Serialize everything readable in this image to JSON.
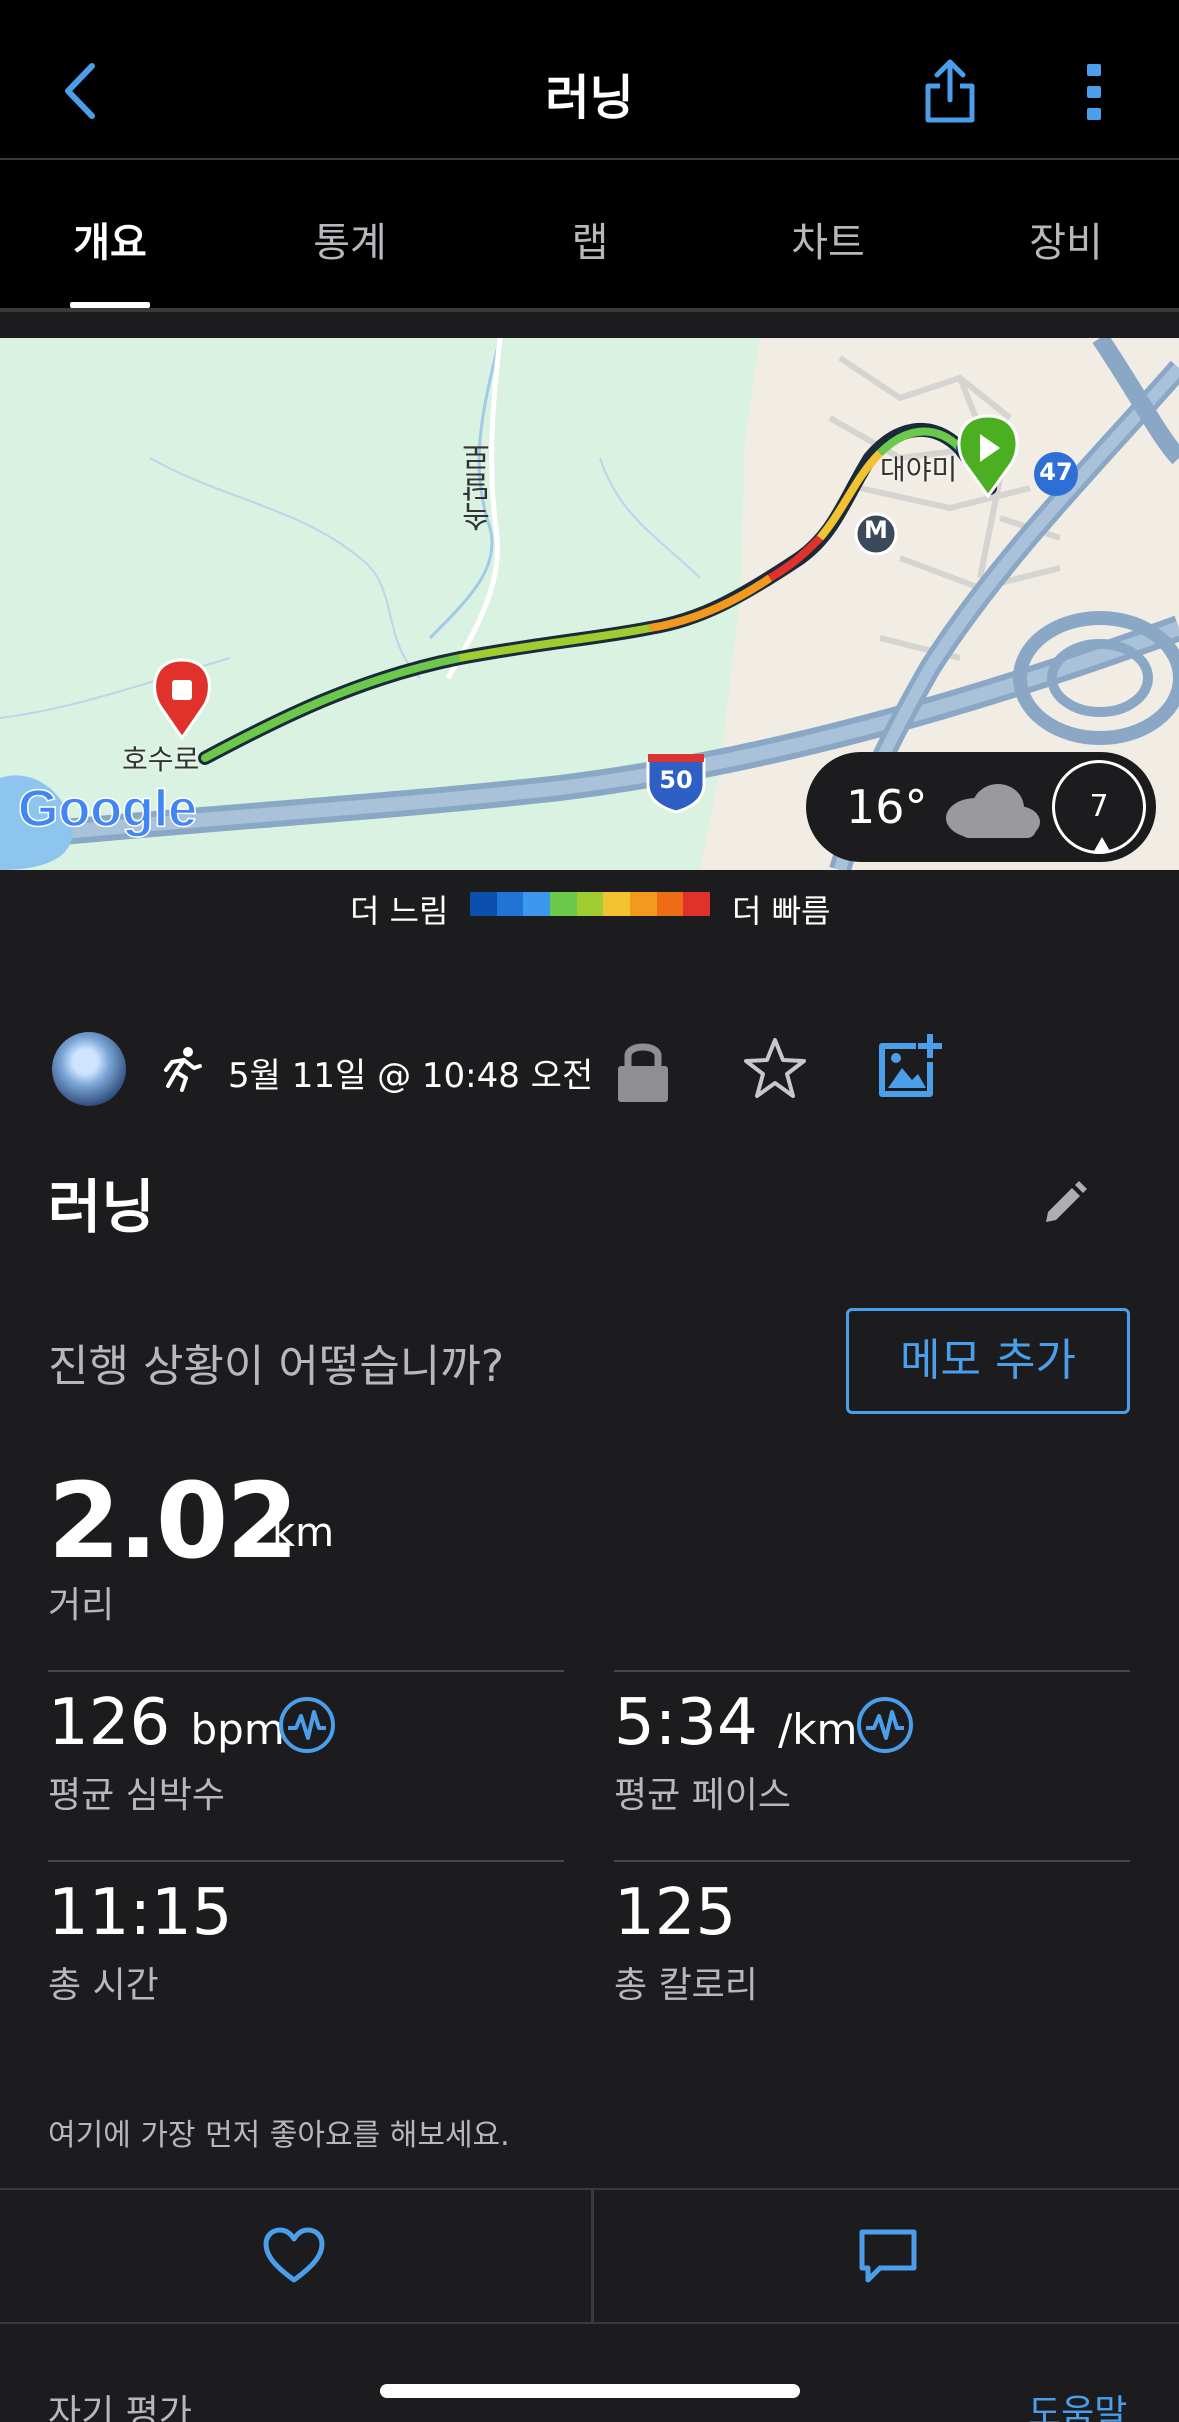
{
  "header": {
    "title": "러닝"
  },
  "tabs": [
    {
      "label": "개요",
      "active": true
    },
    {
      "label": "통계",
      "active": false
    },
    {
      "label": "랩",
      "active": false
    },
    {
      "label": "차트",
      "active": false
    },
    {
      "label": "장비",
      "active": false
    }
  ],
  "map": {
    "labels": {
      "road_vertical": "속달로",
      "place_end": "호수로",
      "place_start": "대야미",
      "route_50": "50",
      "route_47": "47",
      "metro": "M",
      "provider": "Google"
    },
    "weather": {
      "temperature": "16°",
      "wind_speed": "7"
    }
  },
  "pace_legend": {
    "slow_label": "더 느림",
    "fast_label": "더 빠름",
    "colors": [
      "#0a4fae",
      "#1f74d4",
      "#3c98ee",
      "#6cc84a",
      "#9fcc2e",
      "#f1c232",
      "#f39a1e",
      "#ee6b15",
      "#e0312b"
    ]
  },
  "meta": {
    "date_time": "5월 11일 @ 10:48 오전"
  },
  "activity": {
    "title": "러닝",
    "prompt": "진행 상황이 어떻습니까?",
    "memo_button": "메모 추가"
  },
  "distance": {
    "value": "2.02",
    "unit": "km",
    "label": "거리"
  },
  "stats": {
    "heart_rate": {
      "value": "126",
      "unit": "bpm",
      "label": "평균 심박수"
    },
    "pace": {
      "value": "5:34",
      "unit": "/km",
      "label": "평균 페이스"
    },
    "time": {
      "value": "11:15",
      "label": "총 시간"
    },
    "calories": {
      "value": "125",
      "label": "총 칼로리"
    }
  },
  "social": {
    "like_prompt": "여기에 가장 먼저 좋아요를 해보세요."
  },
  "footer": {
    "self_eval": "자기 평가",
    "help": "도움말"
  },
  "colors": {
    "accent": "#4a9eea",
    "background": "#1c1c1e",
    "header_bg": "#000000"
  }
}
